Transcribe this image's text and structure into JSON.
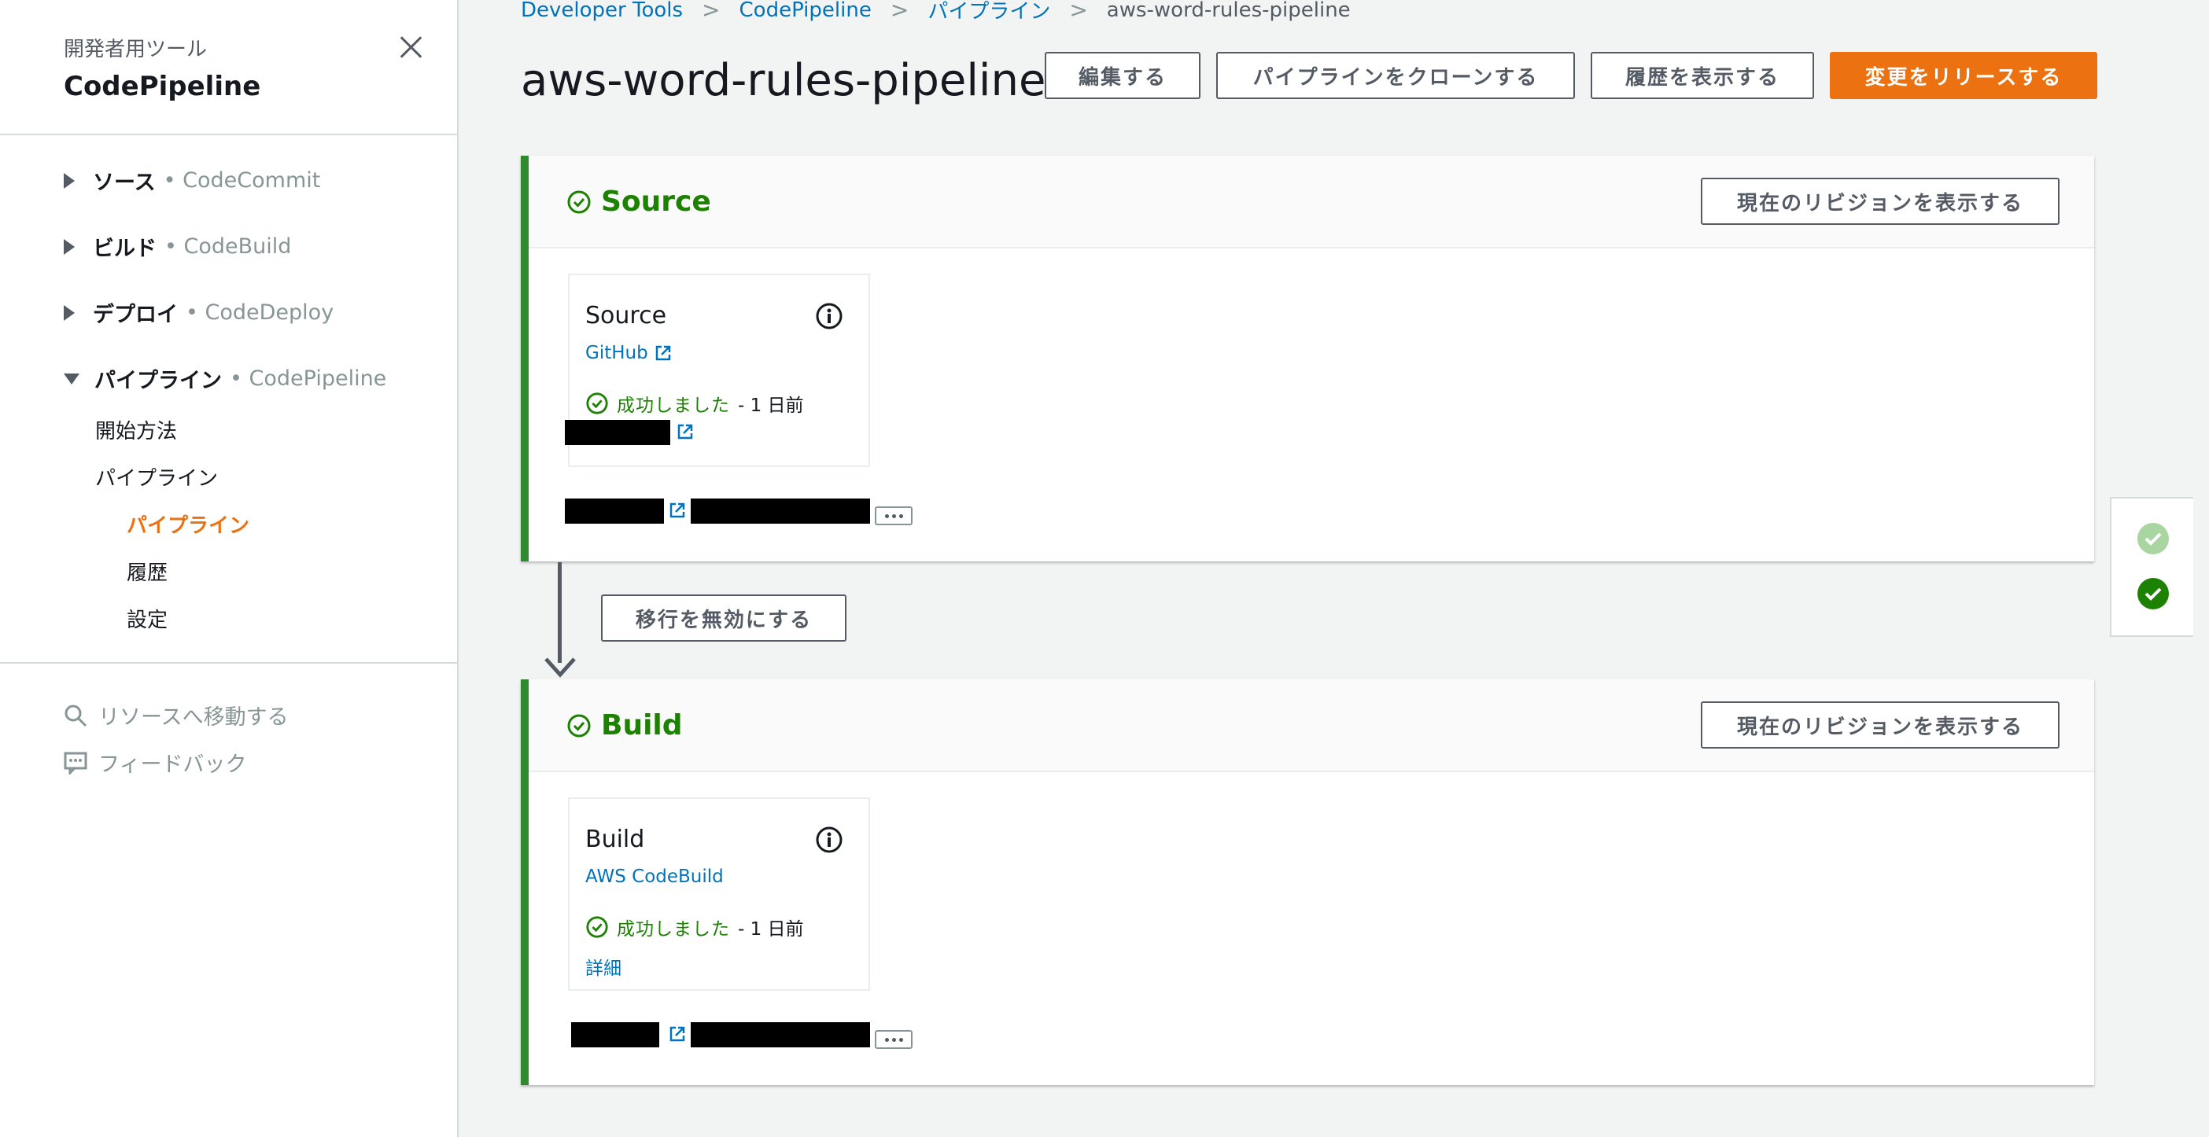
{
  "sidebar": {
    "kicker": "開発者用ツール",
    "title": "CodePipeline",
    "sections": [
      {
        "label": "ソース",
        "service": "• CodeCommit"
      },
      {
        "label": "ビルド",
        "service": "• CodeBuild"
      },
      {
        "label": "デプロイ",
        "service": "• CodeDeploy"
      },
      {
        "label": "パイプライン",
        "service": "• CodePipeline"
      }
    ],
    "links": {
      "getting_started": "開始方法",
      "pipelines_group": "パイプライン",
      "pipelines": "パイプライン",
      "history": "履歴",
      "settings": "設定"
    },
    "go_to_resource": "リソースへ移動する",
    "feedback": "フィードバック"
  },
  "breadcrumb": [
    "Developer Tools",
    "CodePipeline",
    "パイプライン",
    "aws-word-rules-pipeline"
  ],
  "page_title": "aws-word-rules-pipeline",
  "header_buttons": {
    "edit": "編集する",
    "clone": "パイプラインをクローンする",
    "history": "履歴を表示する",
    "release": "変更をリリースする"
  },
  "stages": [
    {
      "name": "Source",
      "revision_button": "現在のリビジョンを表示する",
      "action": {
        "title": "Source",
        "provider": "GitHub",
        "status": "成功しました",
        "ago": "- 1 日前"
      }
    },
    {
      "name": "Build",
      "revision_button": "現在のリビジョンを表示する",
      "action": {
        "title": "Build",
        "provider": "AWS CodeBuild",
        "status": "成功しました",
        "ago": "- 1 日前",
        "details": "詳細"
      }
    }
  ],
  "transition_button": "移行を無効にする",
  "colors": {
    "accent": "#ec7211",
    "success": "#1d8102",
    "link": "#0073bb"
  }
}
